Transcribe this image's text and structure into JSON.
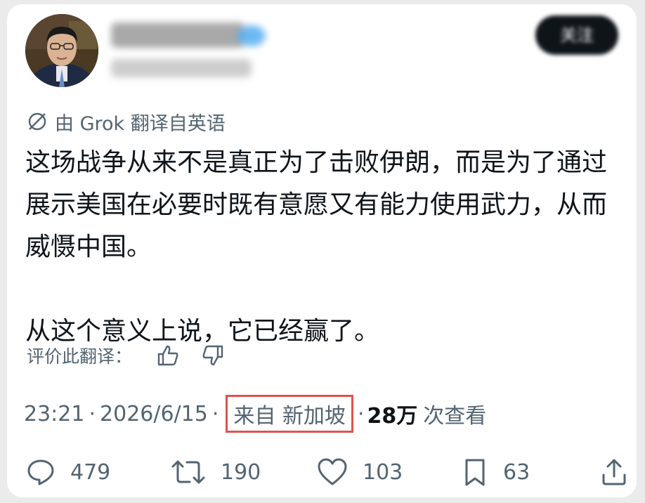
{
  "translation": {
    "label": "由 Grok 翻译自英语",
    "icon": "grok-icon"
  },
  "follow_button": {
    "label": "关注"
  },
  "tweet": {
    "paragraph1": "这场战争从来不是真正为了击败伊朗，而是为了通过展示美国在必要时既有意愿又有能力使用武力，从而威慑中国。",
    "paragraph2": "从这个意义上说，它已经赢了。"
  },
  "rate_translation": {
    "label": "评价此翻译：",
    "thumbs_up_icon": "thumbs-up-icon",
    "thumbs_down_icon": "thumbs-down-icon"
  },
  "meta": {
    "time": "23:21",
    "separator": "·",
    "date": "2026/6/15",
    "location": "来自 新加坡",
    "views_count": "28万",
    "views_label": "次查看",
    "highlight_color": "#e0524e"
  },
  "actions": {
    "replies": "479",
    "retweets": "190",
    "likes": "103",
    "bookmarks": "63"
  },
  "colors": {
    "text": "#0f1419",
    "secondary": "#536471",
    "verified": "#1d9bf0"
  }
}
